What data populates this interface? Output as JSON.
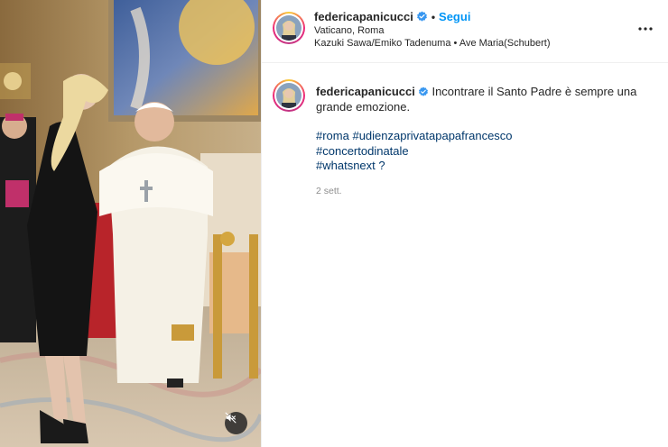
{
  "post": {
    "username": "federicapanicucci",
    "follow_label": "Segui",
    "separator": "•",
    "location": "Vaticano, Roma",
    "audio": {
      "artist": "Kazuki Sawa/Emiko Tadenuma",
      "separator": "•",
      "title": "Ave Maria(Schubert)"
    }
  },
  "caption": {
    "username": "federicapanicucci",
    "text": "Incontrare il Santo Padre è sempre una grande emozione.",
    "hashtags": [
      "#roma #udienzaprivatapapafrancesco",
      "#concertodinatale",
      "#whatsnext ?"
    ],
    "time": "2 sett."
  },
  "icons": {
    "verified": "verified-badge-icon",
    "more": "more-options-icon",
    "mute": "speaker-muted-icon"
  },
  "colors": {
    "link_blue": "#0095f6",
    "hashtag_blue": "#00376b",
    "muted_gray": "#8e8e8e",
    "text": "#262626"
  }
}
